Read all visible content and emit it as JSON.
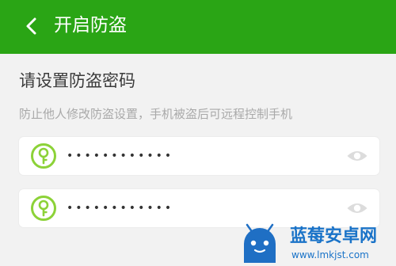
{
  "header": {
    "back_icon": "chevron-left-icon",
    "title": "开启防盗"
  },
  "form": {
    "heading": "请设置防盗密码",
    "subtitle": "防止他人修改防盗设置，手机被盗后可远程控制手机",
    "fields": [
      {
        "icon": "key-icon",
        "value": "••••••••••••",
        "toggle_icon": "eye-icon"
      },
      {
        "icon": "key-icon",
        "value": "••••••••••••",
        "toggle_icon": "eye-icon"
      }
    ]
  },
  "watermark": {
    "name": "蓝莓安卓网",
    "url": "www.lmkjst.com"
  },
  "colors": {
    "header_bg": "#2aa515",
    "key_icon": "#8cd238",
    "watermark_blue": "#1a73c8"
  }
}
